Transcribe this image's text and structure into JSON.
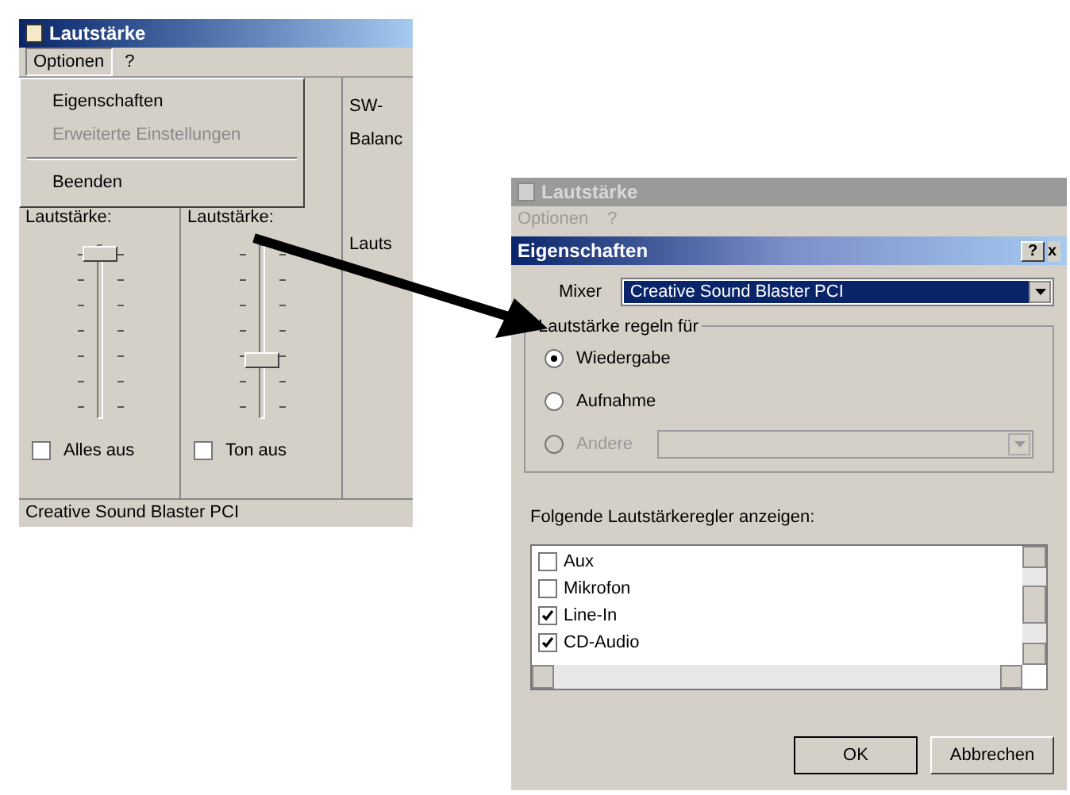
{
  "volume_window": {
    "title": "Lautstärke",
    "menu": [
      {
        "label": "Optionen",
        "selected": true
      },
      {
        "label": "?",
        "selected": false
      }
    ],
    "dropdown_menu": [
      {
        "label": "Eigenschaften",
        "disabled": false,
        "kind": "item"
      },
      {
        "label": "Erweiterte Einstellungen",
        "disabled": true,
        "kind": "item"
      },
      {
        "kind": "separator"
      },
      {
        "label": "Beenden",
        "disabled": false,
        "kind": "item"
      }
    ],
    "channels": [
      {
        "label": "Lautstärke:",
        "level": 0.95,
        "mute_label": "Alles aus",
        "muted": false
      },
      {
        "label": "Lautstärke:",
        "level": 0.3,
        "mute_label": "Ton aus",
        "muted": false
      }
    ],
    "cut_column": {
      "title": "SW-",
      "balance": "Balanc",
      "label": "Lauts"
    },
    "status_bar": "Creative Sound Blaster PCI"
  },
  "background_window": {
    "title": "Lautstärke",
    "menu": [
      "Optionen",
      "?"
    ]
  },
  "properties_dialog": {
    "title": "Eigenschaften",
    "help": "?",
    "close": "x",
    "mixer_label": "Mixer",
    "mixer_value": "Creative Sound Blaster PCI",
    "group_title": "Lautstärke regeln für",
    "radios": [
      {
        "label": "Wiedergabe",
        "selected": true,
        "disabled": false
      },
      {
        "label": "Aufnahme",
        "selected": false,
        "disabled": false
      },
      {
        "label": "Andere",
        "selected": false,
        "disabled": true
      }
    ],
    "list_title": "Folgende Lautstärkeregler anzeigen:",
    "controls": [
      {
        "label": "Aux",
        "checked": false
      },
      {
        "label": "Mikrofon",
        "checked": false
      },
      {
        "label": "Line-In",
        "checked": true
      },
      {
        "label": "CD-Audio",
        "checked": true
      }
    ],
    "buttons": [
      "OK",
      "Abbrechen"
    ]
  }
}
